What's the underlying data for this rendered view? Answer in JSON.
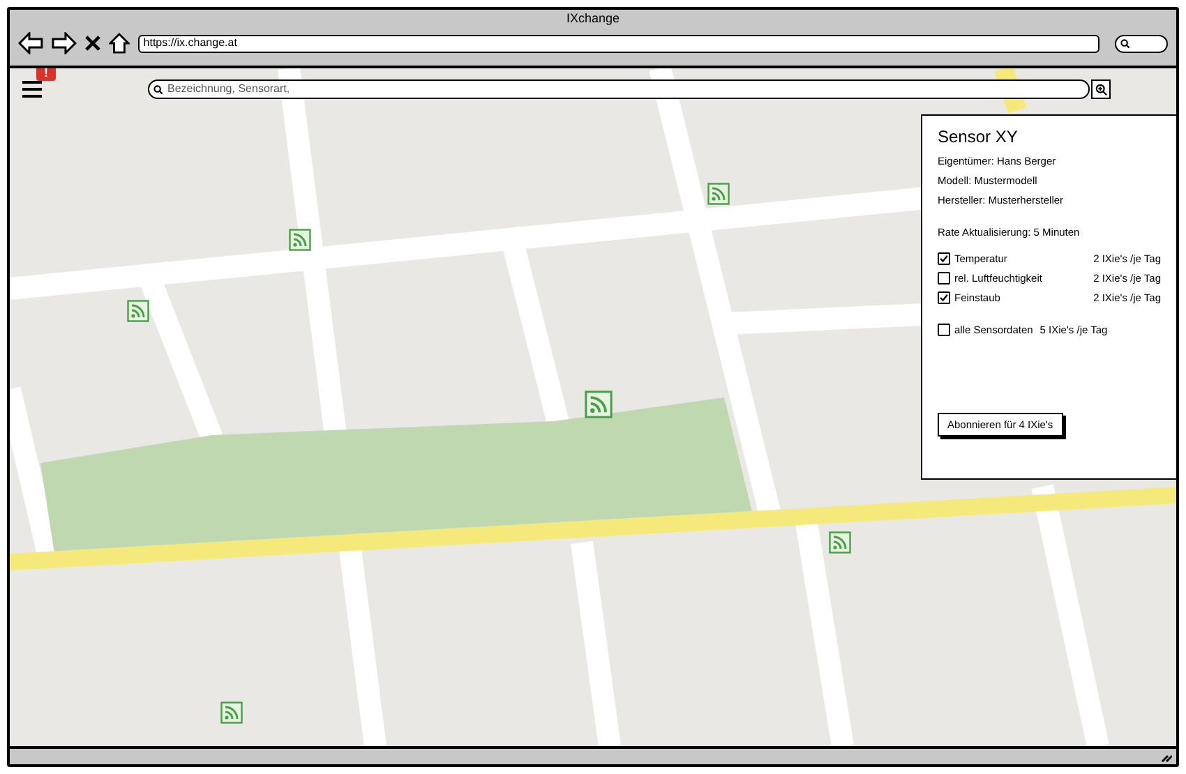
{
  "window": {
    "title": "IXchange"
  },
  "browser": {
    "url": "https://ix.change.at"
  },
  "app": {
    "notification_badge": "!",
    "search": {
      "placeholder": "Bezeichnung, Sensorart,"
    }
  },
  "sensor_panel": {
    "title": "Sensor XY",
    "details": [
      "Eigentümer: Hans Berger",
      "Modell: Mustermodell",
      "Hersteller: Musterhersteller"
    ],
    "rate": "Rate Aktualisierung: 5 Minuten",
    "options": [
      {
        "label": "Temperatur",
        "price": "2 IXie's /je Tag",
        "checked": true
      },
      {
        "label": "rel. Luftfeuchtigkeit",
        "price": "2 IXie's /je Tag",
        "checked": false
      },
      {
        "label": "Feinstaub",
        "price": "2 IXie's /je Tag",
        "checked": true
      }
    ],
    "all_option": {
      "label": "alle Sensordaten",
      "price": "5 IXie's /je Tag",
      "checked": false
    },
    "subscribe_button": "Abonnieren für 4 IXie's"
  }
}
